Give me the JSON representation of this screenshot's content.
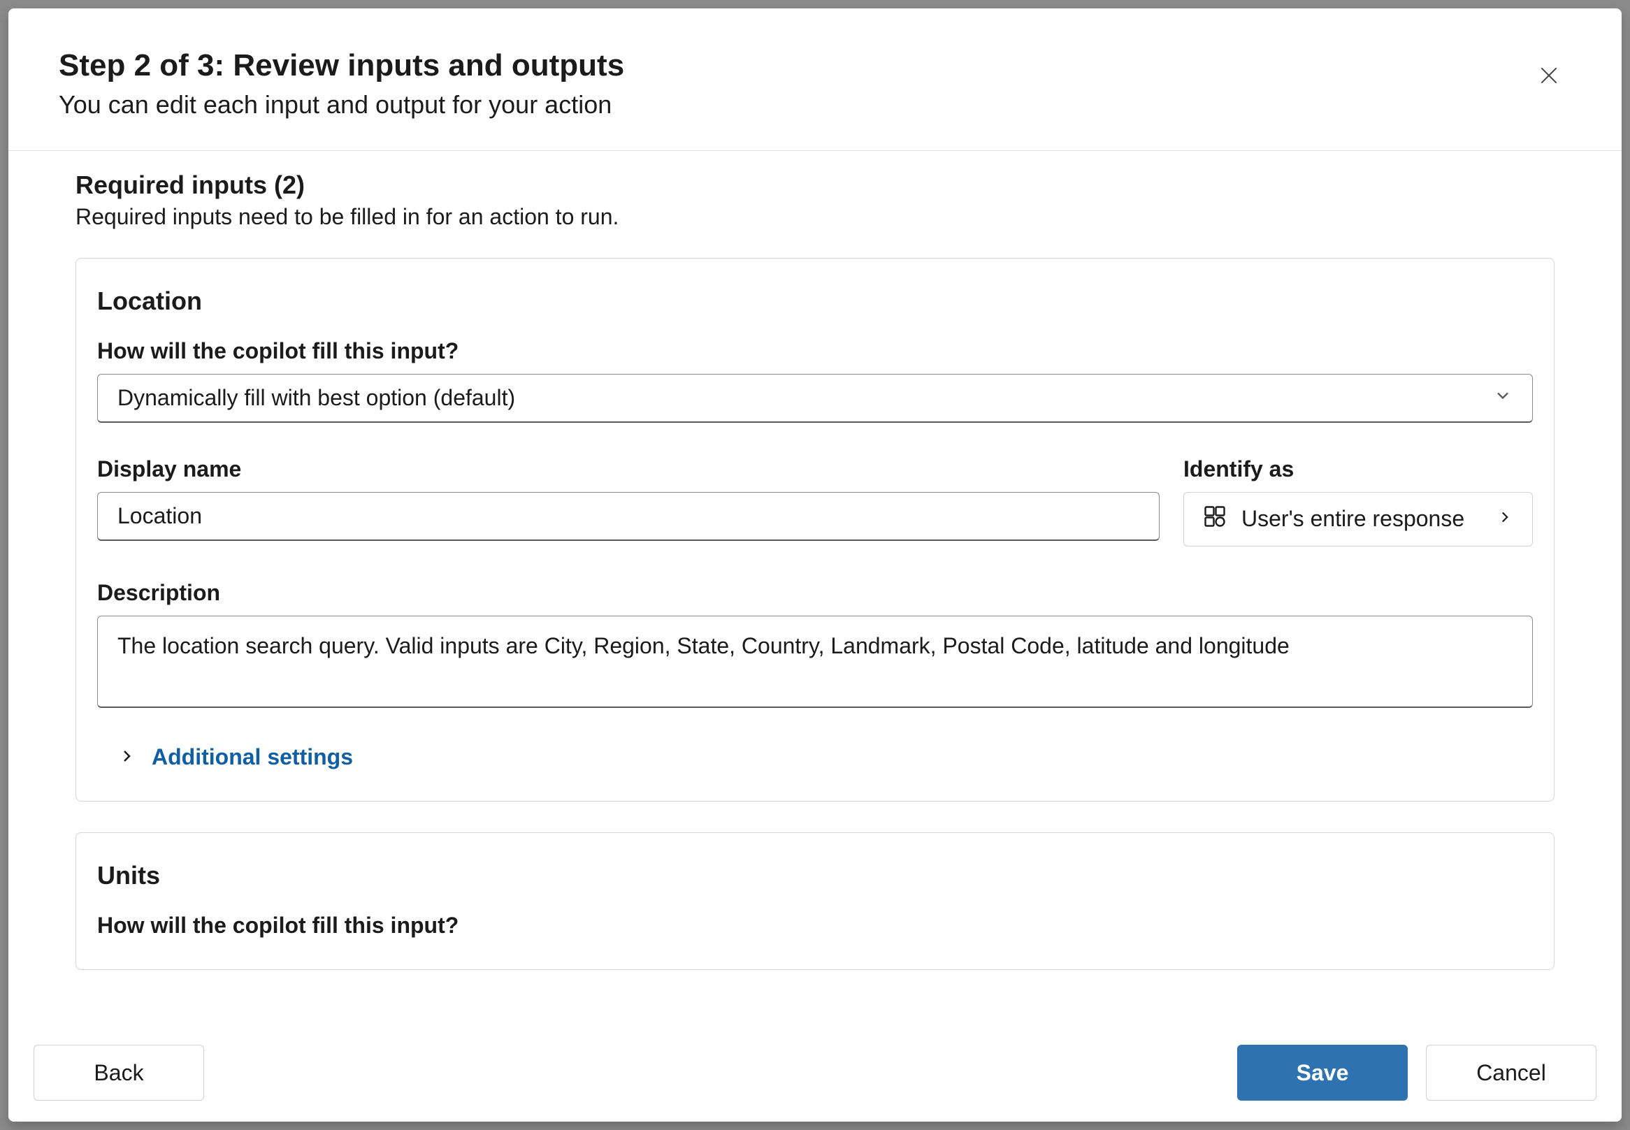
{
  "header": {
    "title": "Step 2 of 3: Review inputs and outputs",
    "subtitle": "You can edit each input and output for your action"
  },
  "section": {
    "title": "Required inputs (2)",
    "subtitle": "Required inputs need to be filled in for an action to run."
  },
  "card1": {
    "title": "Location",
    "fill_label": "How will the copilot fill this input?",
    "fill_value": "Dynamically fill with best option (default)",
    "display_name_label": "Display name",
    "display_name_value": "Location",
    "identify_label": "Identify as",
    "identify_value": "User's entire response",
    "description_label": "Description",
    "description_value": "The location search query. Valid inputs are City, Region, State, Country, Landmark, Postal Code, latitude and longitude",
    "additional_label": "Additional settings"
  },
  "card2": {
    "title": "Units",
    "fill_label": "How will the copilot fill this input?"
  },
  "footer": {
    "back": "Back",
    "save": "Save",
    "cancel": "Cancel"
  }
}
